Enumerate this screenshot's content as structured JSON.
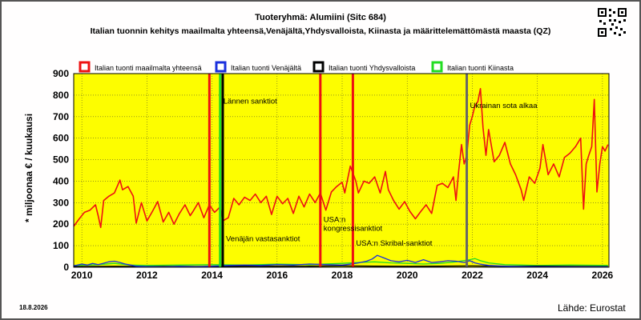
{
  "header": {
    "title": "Tuoteryhmä: Alumiini (Sitc 684)",
    "subtitle": "Italian tuonnin kehitys maailmalta yhteensä,Venäjältä,Yhdysvalloista, Kiinasta ja määrittelemättömästä maasta (QZ)"
  },
  "footer": {
    "date": "18.8.2026",
    "source": "Lähde: Eurostat"
  },
  "colors": {
    "plot_bg": "#fdfd00",
    "world": "#ee1111",
    "russia": "#1a2fdd",
    "usa": "#000000",
    "china": "#22dd22",
    "grid": "#5a5a2a",
    "qr": "qr-code-icon"
  },
  "chart_data": {
    "type": "line",
    "title": "Tuoteryhmä: Alumiini (Sitc 684)",
    "ylabel": "* miljoonaa € / kuukausi",
    "xlabel": "",
    "xlim": [
      2009.75,
      2026.2
    ],
    "ylim": [
      0,
      900
    ],
    "yticks": [
      0,
      100,
      200,
      300,
      400,
      500,
      600,
      700,
      800,
      900
    ],
    "xticks": [
      2010,
      2012,
      2014,
      2016,
      2018,
      2020,
      2022,
      2024,
      2026
    ],
    "grid": true,
    "legend_position": "top",
    "series": [
      {
        "name": "Italian tuonti maailmalta yhteensä",
        "color": "#ee1111",
        "points": [
          [
            2009.75,
            190
          ],
          [
            2009.92,
            225
          ],
          [
            2010.08,
            255
          ],
          [
            2010.25,
            265
          ],
          [
            2010.42,
            290
          ],
          [
            2010.5,
            240
          ],
          [
            2010.58,
            185
          ],
          [
            2010.67,
            310
          ],
          [
            2010.83,
            330
          ],
          [
            2011.0,
            345
          ],
          [
            2011.17,
            405
          ],
          [
            2011.25,
            360
          ],
          [
            2011.42,
            375
          ],
          [
            2011.58,
            330
          ],
          [
            2011.67,
            205
          ],
          [
            2011.83,
            300
          ],
          [
            2012.0,
            215
          ],
          [
            2012.17,
            260
          ],
          [
            2012.33,
            305
          ],
          [
            2012.5,
            210
          ],
          [
            2012.67,
            255
          ],
          [
            2012.83,
            200
          ],
          [
            2013.0,
            250
          ],
          [
            2013.17,
            290
          ],
          [
            2013.33,
            240
          ],
          [
            2013.42,
            260
          ],
          [
            2013.58,
            300
          ],
          [
            2013.75,
            230
          ],
          [
            2013.92,
            290
          ],
          [
            2014.08,
            255
          ],
          [
            2014.25,
            280
          ],
          [
            2014.33,
            215
          ],
          [
            2014.5,
            230
          ],
          [
            2014.67,
            320
          ],
          [
            2014.83,
            290
          ],
          [
            2015.0,
            325
          ],
          [
            2015.17,
            310
          ],
          [
            2015.33,
            340
          ],
          [
            2015.5,
            300
          ],
          [
            2015.67,
            330
          ],
          [
            2015.83,
            245
          ],
          [
            2016.0,
            330
          ],
          [
            2016.17,
            295
          ],
          [
            2016.33,
            320
          ],
          [
            2016.5,
            250
          ],
          [
            2016.67,
            330
          ],
          [
            2016.83,
            280
          ],
          [
            2017.0,
            340
          ],
          [
            2017.17,
            300
          ],
          [
            2017.33,
            345
          ],
          [
            2017.5,
            265
          ],
          [
            2017.67,
            350
          ],
          [
            2017.83,
            375
          ],
          [
            2018.0,
            395
          ],
          [
            2018.08,
            345
          ],
          [
            2018.25,
            470
          ],
          [
            2018.42,
            400
          ],
          [
            2018.5,
            345
          ],
          [
            2018.67,
            400
          ],
          [
            2018.83,
            390
          ],
          [
            2019.0,
            420
          ],
          [
            2019.17,
            345
          ],
          [
            2019.33,
            445
          ],
          [
            2019.42,
            360
          ],
          [
            2019.58,
            310
          ],
          [
            2019.75,
            270
          ],
          [
            2019.92,
            305
          ],
          [
            2020.08,
            260
          ],
          [
            2020.25,
            225
          ],
          [
            2020.42,
            260
          ],
          [
            2020.58,
            290
          ],
          [
            2020.75,
            250
          ],
          [
            2020.92,
            380
          ],
          [
            2021.08,
            390
          ],
          [
            2021.25,
            370
          ],
          [
            2021.42,
            420
          ],
          [
            2021.5,
            310
          ],
          [
            2021.58,
            445
          ],
          [
            2021.67,
            570
          ],
          [
            2021.75,
            480
          ],
          [
            2021.83,
            520
          ],
          [
            2021.92,
            660
          ],
          [
            2022.0,
            700
          ],
          [
            2022.08,
            750
          ],
          [
            2022.17,
            770
          ],
          [
            2022.25,
            830
          ],
          [
            2022.33,
            650
          ],
          [
            2022.42,
            520
          ],
          [
            2022.5,
            640
          ],
          [
            2022.67,
            490
          ],
          [
            2022.83,
            520
          ],
          [
            2023.0,
            580
          ],
          [
            2023.17,
            480
          ],
          [
            2023.33,
            430
          ],
          [
            2023.5,
            360
          ],
          [
            2023.58,
            310
          ],
          [
            2023.75,
            420
          ],
          [
            2023.92,
            390
          ],
          [
            2024.08,
            460
          ],
          [
            2024.17,
            570
          ],
          [
            2024.33,
            430
          ],
          [
            2024.5,
            480
          ],
          [
            2024.67,
            420
          ],
          [
            2024.83,
            510
          ],
          [
            2025.0,
            530
          ],
          [
            2025.17,
            560
          ],
          [
            2025.33,
            600
          ],
          [
            2025.42,
            270
          ],
          [
            2025.5,
            480
          ],
          [
            2025.58,
            520
          ],
          [
            2025.67,
            560
          ],
          [
            2025.75,
            780
          ],
          [
            2025.83,
            350
          ],
          [
            2025.92,
            480
          ],
          [
            2026.0,
            560
          ],
          [
            2026.08,
            540
          ],
          [
            2026.17,
            570
          ]
        ]
      },
      {
        "name": "Italian tuonti Venäjältä",
        "color": "#1a2fdd",
        "points": [
          [
            2009.75,
            6
          ],
          [
            2010.0,
            15
          ],
          [
            2010.17,
            10
          ],
          [
            2010.33,
            18
          ],
          [
            2010.5,
            12
          ],
          [
            2010.83,
            25
          ],
          [
            2011.0,
            28
          ],
          [
            2011.17,
            22
          ],
          [
            2011.33,
            15
          ],
          [
            2011.5,
            10
          ],
          [
            2011.67,
            5
          ],
          [
            2012.0,
            3
          ],
          [
            2012.5,
            2
          ],
          [
            2013.0,
            4
          ],
          [
            2013.5,
            3
          ],
          [
            2014.0,
            5
          ],
          [
            2014.5,
            8
          ],
          [
            2015.0,
            10
          ],
          [
            2015.5,
            8
          ],
          [
            2016.0,
            12
          ],
          [
            2016.5,
            10
          ],
          [
            2017.0,
            15
          ],
          [
            2017.5,
            12
          ],
          [
            2018.0,
            10
          ],
          [
            2018.25,
            14
          ],
          [
            2018.5,
            20
          ],
          [
            2018.75,
            28
          ],
          [
            2018.92,
            38
          ],
          [
            2019.08,
            55
          ],
          [
            2019.25,
            45
          ],
          [
            2019.5,
            30
          ],
          [
            2019.75,
            25
          ],
          [
            2020.0,
            32
          ],
          [
            2020.25,
            22
          ],
          [
            2020.5,
            35
          ],
          [
            2020.75,
            22
          ],
          [
            2021.0,
            25
          ],
          [
            2021.25,
            30
          ],
          [
            2021.5,
            28
          ],
          [
            2021.75,
            22
          ],
          [
            2021.92,
            30
          ],
          [
            2022.08,
            20
          ],
          [
            2022.25,
            14
          ],
          [
            2022.5,
            8
          ],
          [
            2023.0,
            5
          ],
          [
            2023.5,
            3
          ],
          [
            2024.0,
            2
          ],
          [
            2024.5,
            2
          ],
          [
            2025.0,
            2
          ],
          [
            2025.5,
            2
          ],
          [
            2026.17,
            2
          ]
        ]
      },
      {
        "name": "Italian tuonti Yhdysvalloista",
        "color": "#000000",
        "points": [
          [
            2009.75,
            3
          ],
          [
            2011.0,
            4
          ],
          [
            2012.0,
            3
          ],
          [
            2013.0,
            4
          ],
          [
            2014.0,
            3
          ],
          [
            2015.0,
            5
          ],
          [
            2016.0,
            4
          ],
          [
            2017.0,
            5
          ],
          [
            2018.0,
            6
          ],
          [
            2019.0,
            5
          ],
          [
            2020.0,
            4
          ],
          [
            2021.0,
            5
          ],
          [
            2022.0,
            6
          ],
          [
            2023.0,
            4
          ],
          [
            2024.0,
            5
          ],
          [
            2025.0,
            4
          ],
          [
            2026.17,
            3
          ]
        ]
      },
      {
        "name": "Italian tuonti Kiinasta",
        "color": "#22dd22",
        "points": [
          [
            2009.75,
            8
          ],
          [
            2010.5,
            12
          ],
          [
            2011.0,
            18
          ],
          [
            2011.5,
            10
          ],
          [
            2012.0,
            8
          ],
          [
            2013.0,
            10
          ],
          [
            2014.0,
            12
          ],
          [
            2015.0,
            10
          ],
          [
            2016.0,
            14
          ],
          [
            2017.0,
            12
          ],
          [
            2018.0,
            18
          ],
          [
            2018.5,
            22
          ],
          [
            2019.0,
            25
          ],
          [
            2019.5,
            20
          ],
          [
            2020.0,
            18
          ],
          [
            2020.5,
            15
          ],
          [
            2021.0,
            18
          ],
          [
            2021.5,
            25
          ],
          [
            2021.92,
            35
          ],
          [
            2022.08,
            40
          ],
          [
            2022.25,
            30
          ],
          [
            2022.5,
            20
          ],
          [
            2023.0,
            12
          ],
          [
            2023.5,
            10
          ],
          [
            2024.0,
            8
          ],
          [
            2025.0,
            10
          ],
          [
            2026.17,
            8
          ]
        ]
      }
    ],
    "events": [
      {
        "x": 2013.92,
        "color": "#ee1111",
        "label": ""
      },
      {
        "x": 2014.25,
        "color": "#22dd22",
        "label": "Lännen sanktiot",
        "label_y": 760
      },
      {
        "x": 2014.33,
        "color": "#000000",
        "label": "Venäjän vastasanktiot",
        "label_y": 120
      },
      {
        "x": 2017.33,
        "color": "#ee1111",
        "label": "USA:n kongressisanktiot",
        "label_y": 210
      },
      {
        "x": 2018.33,
        "color": "#ee1111",
        "label": "USA:n Skribal-sanktiot",
        "label_y": 100
      },
      {
        "x": 2021.83,
        "color": "#666666",
        "label": "Ukrainan sota alkaa",
        "label_y": 740
      }
    ]
  }
}
